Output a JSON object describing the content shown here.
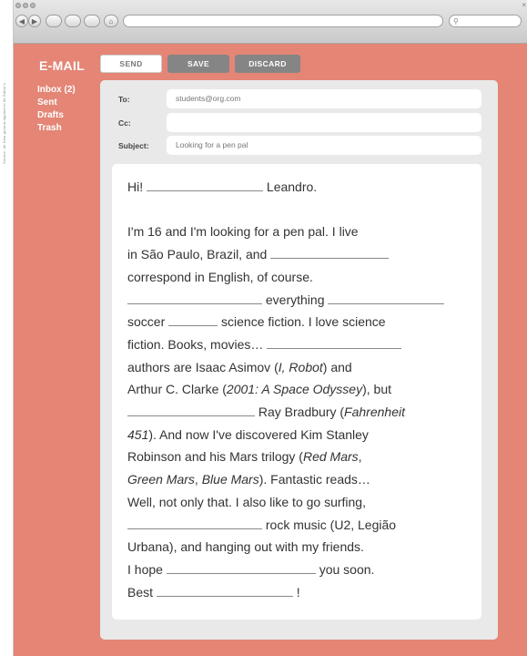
{
  "side_credit": "Source: de New ground applied in de Editor's",
  "browser": {
    "back": "◀",
    "forward": "▶",
    "home": "⌂",
    "search_glass": "⚲",
    "close": "×"
  },
  "app": {
    "logo": "E-MAIL"
  },
  "sidebar": {
    "items": [
      {
        "label": "Inbox (2)"
      },
      {
        "label": "Sent"
      },
      {
        "label": "Drafts"
      },
      {
        "label": "Trash"
      }
    ]
  },
  "toolbar": {
    "send_label": "SEND",
    "save_label": "SAVE",
    "discard_label": "DISCARD"
  },
  "compose": {
    "to_label": "To:",
    "to_value": "students@org.com",
    "cc_label": "Cc:",
    "cc_value": "",
    "subject_label": "Subject:",
    "subject_value": "Looking for a pen pal"
  },
  "letter": {
    "l1a": "Hi!",
    "l1b": "Leandro.",
    "l2": "I'm 16 and I'm looking for a pen pal. I live",
    "l3": "in São Paulo, Brazil, and",
    "l4": "correspond in English, of course.",
    "l5": "everything",
    "l6a": "soccer",
    "l6b": "science fiction. I love science",
    "l7": "fiction. Books, movies…",
    "l8a": "authors are Isaac Asimov (",
    "l8b": "I, Robot",
    "l8c": ") and",
    "l9a": "Arthur C. Clarke (",
    "l9b": "2001: A Space Odyssey",
    "l9c": "), but",
    "l10a": "Ray Bradbury (",
    "l10b": "Fahrenheit",
    "l11a": "451",
    "l11b": "). And now I've discovered Kim Stanley",
    "l12a": "Robinson and his Mars trilogy (",
    "l12b": "Red Mars",
    "l12c": ",",
    "l13a": "Green Mars",
    "l13b": ", ",
    "l13c": "Blue Mars",
    "l13d": "). Fantastic reads…",
    "l14": "Well, not only that. I also like to go surfing,",
    "l15": "rock music (U2, Legião",
    "l16": "Urbana), and hanging out with my friends.",
    "l17a": "I hope",
    "l17b": "you soon.",
    "l18a": "Best",
    "l18b": "!"
  }
}
